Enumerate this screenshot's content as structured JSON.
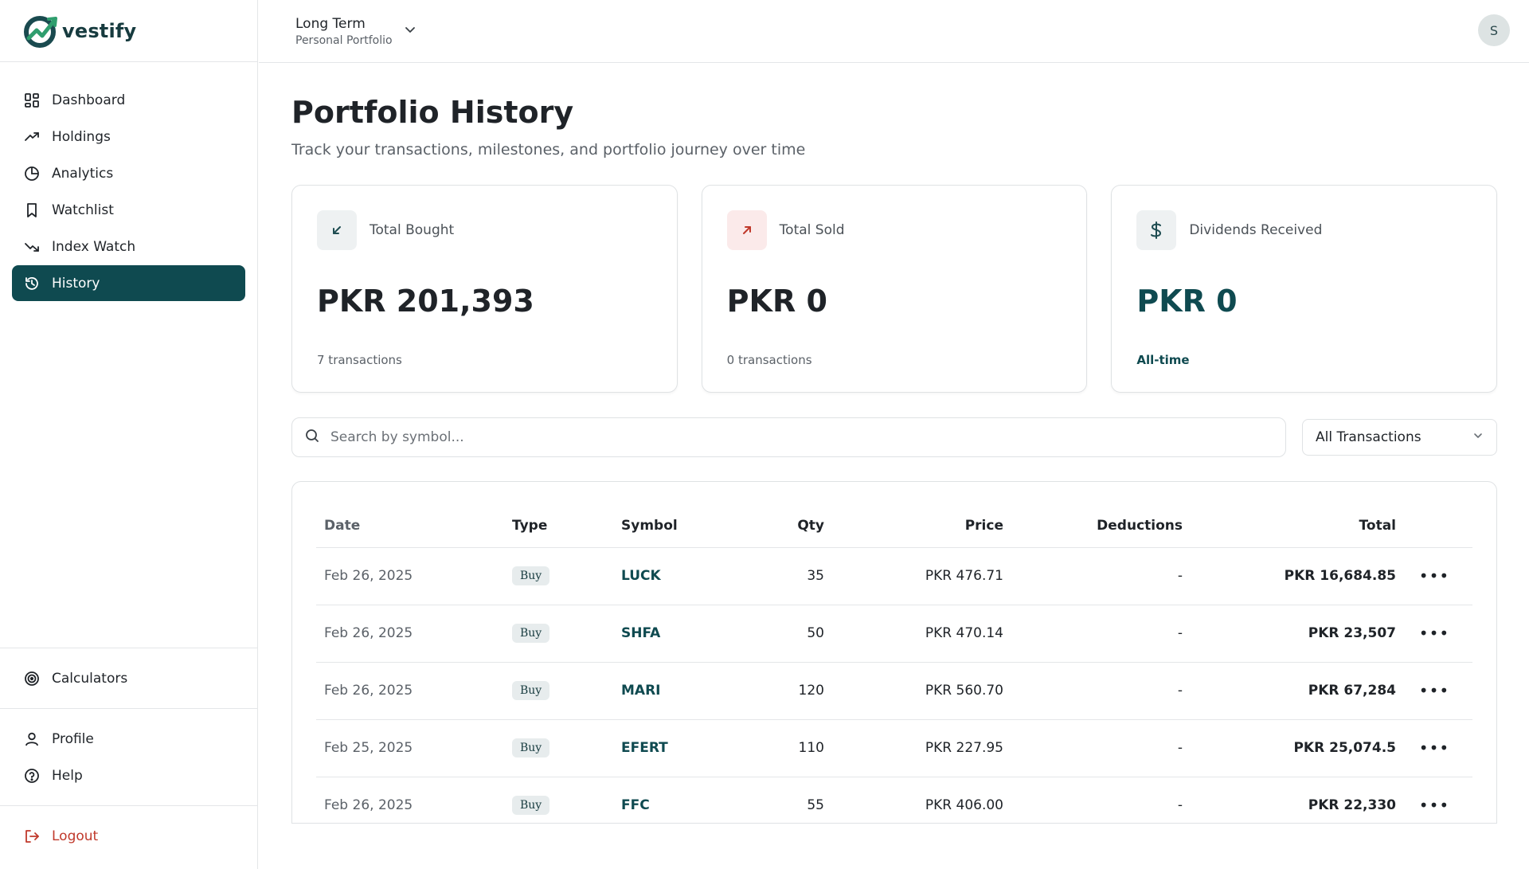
{
  "app": {
    "brand": "vestify"
  },
  "sidebar": {
    "items": [
      {
        "label": "Dashboard",
        "icon": "dashboard-icon"
      },
      {
        "label": "Holdings",
        "icon": "trending-up-icon"
      },
      {
        "label": "Analytics",
        "icon": "pie-chart-icon"
      },
      {
        "label": "Watchlist",
        "icon": "bookmark-icon"
      },
      {
        "label": "Index Watch",
        "icon": "trending-down-icon"
      },
      {
        "label": "History",
        "icon": "history-icon",
        "active": true
      }
    ],
    "calculators": "Calculators",
    "profile": "Profile",
    "help": "Help",
    "logout": "Logout"
  },
  "header": {
    "portfolio_title": "Long Term",
    "portfolio_subtitle": "Personal Portfolio",
    "avatar_initial": "S"
  },
  "page": {
    "title": "Portfolio History",
    "subtitle": "Track your transactions, milestones, and portfolio journey over time"
  },
  "cards": {
    "bought": {
      "label": "Total Bought",
      "value": "PKR 201,393",
      "foot": "7 transactions"
    },
    "sold": {
      "label": "Total Sold",
      "value": "PKR 0",
      "foot": "0 transactions"
    },
    "dividends": {
      "label": "Dividends Received",
      "value": "PKR 0",
      "foot": "All-time"
    }
  },
  "filters": {
    "search_placeholder": "Search by symbol...",
    "type_selected": "All Transactions"
  },
  "table": {
    "headers": {
      "date": "Date",
      "type": "Type",
      "symbol": "Symbol",
      "qty": "Qty",
      "price": "Price",
      "deductions": "Deductions",
      "total": "Total"
    },
    "rows": [
      {
        "date": "Feb 26, 2025",
        "type": "Buy",
        "symbol": "LUCK",
        "qty": "35",
        "price": "PKR 476.71",
        "deductions": "-",
        "total": "PKR 16,684.85"
      },
      {
        "date": "Feb 26, 2025",
        "type": "Buy",
        "symbol": "SHFA",
        "qty": "50",
        "price": "PKR 470.14",
        "deductions": "-",
        "total": "PKR 23,507"
      },
      {
        "date": "Feb 26, 2025",
        "type": "Buy",
        "symbol": "MARI",
        "qty": "120",
        "price": "PKR 560.70",
        "deductions": "-",
        "total": "PKR 67,284"
      },
      {
        "date": "Feb 25, 2025",
        "type": "Buy",
        "symbol": "EFERT",
        "qty": "110",
        "price": "PKR 227.95",
        "deductions": "-",
        "total": "PKR 25,074.5"
      },
      {
        "date": "Feb 26, 2025",
        "type": "Buy",
        "symbol": "FFC",
        "qty": "55",
        "price": "PKR 406.00",
        "deductions": "-",
        "total": "PKR 22,330"
      }
    ]
  },
  "colors": {
    "accent": "#0f4a50",
    "danger": "#c0392b",
    "sold_bg": "#fbeaea",
    "neutral_bg": "#eef1f2"
  }
}
